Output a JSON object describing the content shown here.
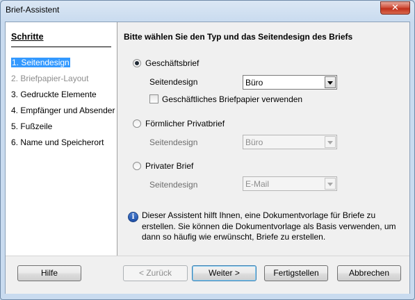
{
  "window": {
    "title": "Brief-Assistent"
  },
  "sidebar": {
    "title": "Schritte",
    "steps": [
      {
        "label": "1. Seitendesign",
        "state": "active"
      },
      {
        "label": "2. Briefpapier-Layout",
        "state": "disabled"
      },
      {
        "label": "3. Gedruckte Elemente",
        "state": "normal"
      },
      {
        "label": "4. Empfänger und Absender",
        "state": "normal"
      },
      {
        "label": "5. Fußzeile",
        "state": "normal"
      },
      {
        "label": "6. Name und Speicherort",
        "state": "normal"
      }
    ]
  },
  "main": {
    "heading": "Bitte wählen Sie den Typ und das Seitendesign des Briefs",
    "options": [
      {
        "label": "Geschäftsbrief",
        "checked": true,
        "design_label": "Seitendesign",
        "design_value": "Büro",
        "enabled": true
      },
      {
        "label": "Förmlicher Privatbrief",
        "checked": false,
        "design_label": "Seitendesign",
        "design_value": "Büro",
        "enabled": false
      },
      {
        "label": "Privater Brief",
        "checked": false,
        "design_label": "Seitendesign",
        "design_value": "E-Mail",
        "enabled": false
      }
    ],
    "letterhead_checkbox": {
      "label": "Geschäftliches Briefpapier verwenden",
      "checked": false
    },
    "info_lines": [
      "Dieser Assistent hilft Ihnen, eine Dokumentvorlage für Briefe zu",
      "erstellen. Sie können die Dokumentvorlage als Basis verwenden, um",
      "dann so häufig wie erwünscht, Briefe zu erstellen."
    ]
  },
  "footer": {
    "help": "Hilfe",
    "back": "< Zurück",
    "next": "Weiter >",
    "finish": "Fertigstellen",
    "cancel": "Abbrechen"
  },
  "colors": {
    "selection": "#3399ff",
    "window_frame": "#c9dbef",
    "close_button": "#c0301b"
  },
  "icons": {
    "close": "close-icon",
    "info": "info-icon",
    "dropdown": "chevron-down-icon"
  }
}
